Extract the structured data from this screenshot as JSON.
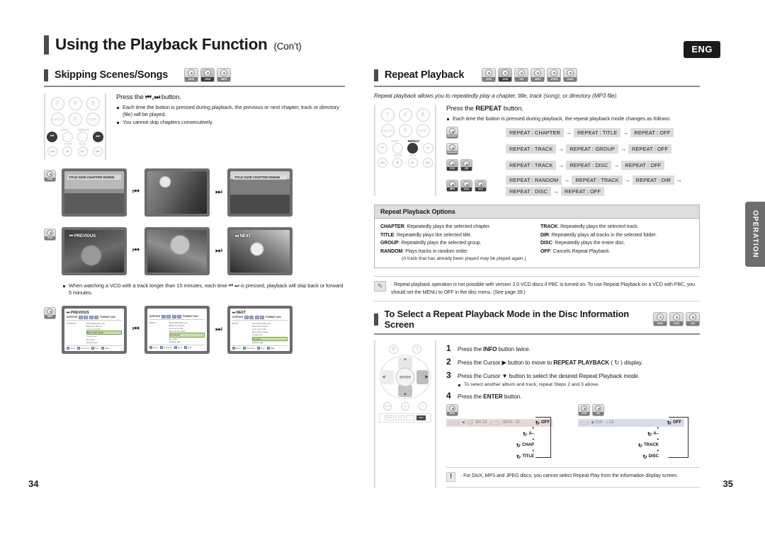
{
  "header": {
    "title": "Using the Playback Function",
    "title_suffix": "(Con’t)",
    "lang_badge": "ENG"
  },
  "pages": {
    "left": "34",
    "right": "35"
  },
  "side_tab": {
    "label": "OPERATION"
  },
  "left_column": {
    "section": {
      "title": "Skipping Scenes/Songs",
      "discs": [
        {
          "label": "DVD",
          "dark": false
        },
        {
          "label": "VCD",
          "dark": true
        },
        {
          "label": "MP3",
          "dark": false
        }
      ]
    },
    "instruction": {
      "lead_prefix": "Press the",
      "lead_icons": "⏮ , ⏭",
      "lead_suffix": "button.",
      "bullets": [
        "Each time the button is pressed during playback, the previous or next chapter, track or directory (file) will be played.",
        "You cannot skip chapters consecutively."
      ]
    },
    "rows": [
      {
        "marker": "DVD",
        "screens": [
          {
            "osd": "TITLE 01/05 CHAPTER  002/045",
            "osd_style": "box",
            "photo": "ph-desert"
          },
          {
            "osd": "",
            "osd_style": "none",
            "photo": "ph-cactus"
          },
          {
            "osd": "TITLE 01/05 CHAPTER  004/045",
            "osd_style": "box",
            "photo": "ph-river"
          }
        ],
        "skip_prev": "⏮",
        "skip_next": "⏭"
      },
      {
        "marker": "VCD",
        "screens": [
          {
            "osd": "⏮ PREVIOUS",
            "osd_style": "light",
            "photo": "ph-squirrel"
          },
          {
            "osd": "",
            "osd_style": "none",
            "photo": "ph-cheetah"
          },
          {
            "osd": "⏭ NEXT",
            "osd_style": "light",
            "photo": "ph-raccoon"
          }
        ],
        "skip_prev": "⏮",
        "skip_next": "⏭"
      }
    ],
    "vcd_note": "When watching a VCD with a track longer than 15 minutes, each time  ⏮ ⏭  is pressed, playback will skip back or forward 5 minutes.",
    "mp3_row": {
      "marker": "MP3",
      "screens": [
        {
          "caption": "⏮ PREVIOUS",
          "sorting": "SORTING",
          "playlist_title": "FORMAT NAV",
          "folder": "1/2 ROOT",
          "tracks": [
            "Something like you",
            "Mans for others",
            "Love of my life",
            "More than words",
            "I need you",
            "No tears",
            "Uptown girl"
          ],
          "selected_index": 3,
          "buttons": [
            "Move",
            "Previous",
            "Next",
            "Skip"
          ]
        },
        {
          "caption": "",
          "sorting": "SORTING",
          "playlist_title": "FORMAT NAV",
          "folder": "ROOT",
          "tracks": [
            "Something like you",
            "Mans for others",
            "Love of my life",
            "More than words",
            "I need you",
            "No tears",
            "Uptown girl"
          ],
          "selected_index": 4,
          "buttons": [
            "Move",
            "Previous",
            "Next",
            "Skip"
          ]
        },
        {
          "caption": "⏭ NEXT",
          "sorting": "SORTING",
          "playlist_title": "FORMAT NAV",
          "folder": "ROOT",
          "tracks": [
            "Something like you",
            "Mans for others",
            "Love of my life",
            "More than words",
            "I need you",
            "No tears",
            "Uptown girl"
          ],
          "selected_index": 5,
          "buttons": [
            "Move",
            "Previous",
            "Next",
            "Skip"
          ]
        }
      ],
      "skip_prev": "⏮",
      "skip_next": "⏭"
    },
    "remote": {
      "num_buttons": [
        "7",
        "8",
        "9",
        "CANCEL",
        "0",
        "DVD"
      ],
      "label_step": "STEP",
      "label_repeat": "REPEAT",
      "label_stop": "STOP",
      "label_play": "PLAY",
      "transport": [
        "⏮",
        "",
        "",
        "⏭"
      ],
      "transport2": [
        "◀◀",
        "■",
        "▶‖",
        "▶▶"
      ]
    }
  },
  "right_column": {
    "section": {
      "title": "Repeat Playback",
      "discs": [
        {
          "label": "DVD",
          "dark": false
        },
        {
          "label": "VCD",
          "dark": true
        },
        {
          "label": "CD",
          "dark": false
        },
        {
          "label": "MP3",
          "dark": false
        },
        {
          "label": "JPEG",
          "dark": false
        },
        {
          "label": "DivX",
          "dark": false
        }
      ]
    },
    "intro": "Repeat playback allows you to repeatedly play a chapter, title, track (song), or directory (MP3 file).",
    "instruction": {
      "lead_prefix": "Press the",
      "lead_bold": "REPEAT",
      "lead_suffix": "button.",
      "bullet": "Each time the button is pressed during playback, the repeat playback mode changes as follows:"
    },
    "sequences": [
      {
        "discs": [
          {
            "label": "DVD-VIDEO",
            "dark": false
          }
        ],
        "terms": [
          "REPEAT : CHAPTER",
          "REPEAT : TITLE",
          "REPEAT : OFF"
        ]
      },
      {
        "discs": [
          {
            "label": "DVD-AUDIO",
            "dark": false
          }
        ],
        "terms": [
          "REPEAT : TRACK",
          "REPEAT : GROUP",
          "REPEAT : OFF"
        ]
      },
      {
        "discs": [
          {
            "label": "VCD",
            "dark": true
          },
          {
            "label": "CD",
            "dark": true
          }
        ],
        "terms": [
          "REPEAT : TRACK",
          "REPEAT : DISC",
          "REPEAT : OFF"
        ]
      },
      {
        "discs": [
          {
            "label": "MP3",
            "dark": true
          },
          {
            "label": "JPEG",
            "dark": true
          },
          {
            "label": "DivX",
            "dark": true
          }
        ],
        "terms": [
          "REPEAT : RANDOM",
          "REPEAT : TRACK",
          "REPEAT : DIR",
          "REPEAT : DISC",
          "REPEAT : OFF"
        ]
      }
    ],
    "options": {
      "title": "Repeat Playback Options",
      "left": [
        {
          "term": "CHAPTER",
          "desc": ": Repeatedly plays the selected chapter."
        },
        {
          "term": "TITLE",
          "desc": ": Repeatedly plays the selected title."
        },
        {
          "term": "GROUP",
          "desc": ": Repeatedly plays the selected group."
        },
        {
          "term": "RANDOM",
          "desc": ": Plays tracks in random order."
        }
      ],
      "left_sub": "(A track that has already been played may be played again.)",
      "right": [
        {
          "term": "TRACK",
          "desc": ": Repeatedly plays the selected track."
        },
        {
          "term": "DIR",
          "desc": ": Repeatedly plays all tracks in the selected folder."
        },
        {
          "term": "DISC",
          "desc": ": Repeatedly plays the entire disc."
        },
        {
          "term": "OFF",
          "desc": ": Cancels Repeat Playback."
        }
      ]
    },
    "note": "Repeat playback operation is not possible with version 2.0 VCD discs if PBC is turned on. To use Repeat Playback on a VCD with PBC, you should set the MENU to OFF in the disc menu. (See page 39.)",
    "section2": {
      "title": "To Select a Repeat Playback Mode in the Disc Information Screen",
      "discs": [
        {
          "label": "DVD",
          "dark": false
        },
        {
          "label": "VCD",
          "dark": false
        },
        {
          "label": "CD",
          "dark": false
        }
      ]
    },
    "steps": [
      {
        "n": "1",
        "text_parts": [
          "Press the ",
          "INFO",
          " button twice."
        ]
      },
      {
        "n": "2",
        "text_parts": [
          "Press the Cursor ▶ button to move to ",
          "REPEAT PLAYBACK",
          " ( ↻ ) display."
        ]
      },
      {
        "n": "3",
        "text_parts": [
          "Press the Cursor ▼ button to select the desired Repeat Playback mode."
        ]
      },
      {
        "n": "4",
        "text_parts": [
          "Press the ",
          "ENTER",
          " button."
        ]
      }
    ],
    "substep": "To select another album and track, repeat Steps 2 and 3 above.",
    "osd_diagrams": [
      {
        "discs": [
          {
            "label": "DVD",
            "dark": false
          }
        ],
        "bar_style": "pink",
        "bar_items": [
          "DVD",
          "◀",
          "①",
          "EN 1/2",
          "SUB",
          "OFF/1",
          "02"
        ],
        "selected": "OFF",
        "chain": [
          "A–",
          "CHAP",
          "TITLE"
        ]
      },
      {
        "discs": [
          {
            "label": "VCD",
            "dark": false
          },
          {
            "label": "CD",
            "dark": false
          }
        ],
        "bar_style": "blue",
        "bar_items": [
          "CD",
          "◉ 0:00",
          "♫ LR"
        ],
        "selected": "OFF",
        "chain": [
          "A–",
          "TRACK",
          "DISC"
        ]
      }
    ],
    "warning": "For DivX, MP3 and JPEG discs, you cannot select Repeat Play from the information display screen.",
    "remote2": {
      "enter": "ENTER",
      "labels": [
        "MENU",
        "RETURN",
        "EXIT"
      ],
      "bottom_labels": [
        "MODE",
        "DTS",
        "SLOW",
        "SD/TUNE",
        "SOUND EDIT",
        "MP3"
      ]
    }
  }
}
